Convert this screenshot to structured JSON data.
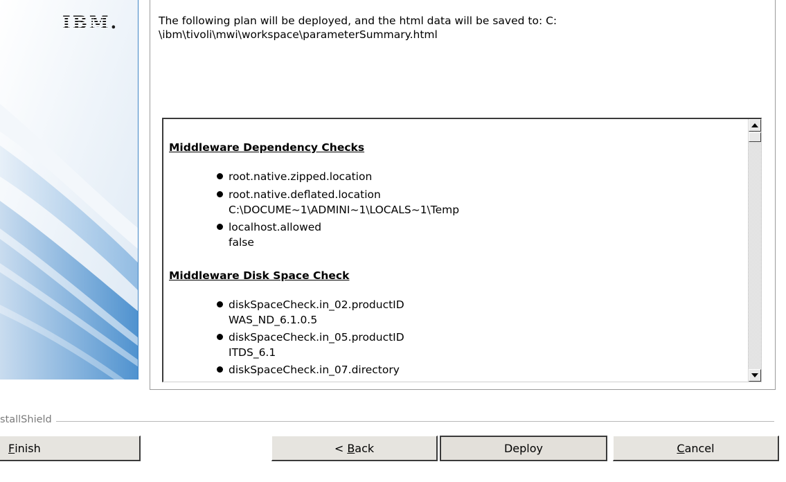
{
  "branding": {
    "logo_text": "IBM"
  },
  "intro": {
    "text": "The following plan will be deployed, and the html data will be saved to: C:\n\\ibm\\tivoli\\mwi\\workspace\\parameterSummary.html"
  },
  "summary": {
    "sections": [
      {
        "title": "Middleware Dependency Checks",
        "items": [
          {
            "name": "root.native.zipped.location",
            "value": ""
          },
          {
            "name": "root.native.deflated.location",
            "value": "C:\\DOCUME~1\\ADMINI~1\\LOCALS~1\\Temp"
          },
          {
            "name": "localhost.allowed",
            "value": "false"
          }
        ]
      },
      {
        "title": "Middleware Disk Space Check",
        "items": [
          {
            "name": "diskSpaceCheck.in_02.productID",
            "value": "WAS_ND_6.1.0.5"
          },
          {
            "name": "diskSpaceCheck.in_05.productID",
            "value": "ITDS_6.1"
          },
          {
            "name": "diskSpaceCheck.in_07.directory",
            "value": ""
          }
        ]
      }
    ]
  },
  "footer": {
    "installshield_label": "stallShield",
    "buttons": {
      "finish": {
        "mnemonic": "F",
        "rest": "inish"
      },
      "back": {
        "prefix": "< ",
        "mnemonic": "B",
        "rest": "ack"
      },
      "deploy": {
        "label": "Deploy"
      },
      "cancel": {
        "mnemonic": "C",
        "rest": "ancel"
      }
    }
  },
  "colors": {
    "banner_light": "#eef3f9",
    "banner_dark": "#3f84c4",
    "button_face": "#e6e4df"
  }
}
